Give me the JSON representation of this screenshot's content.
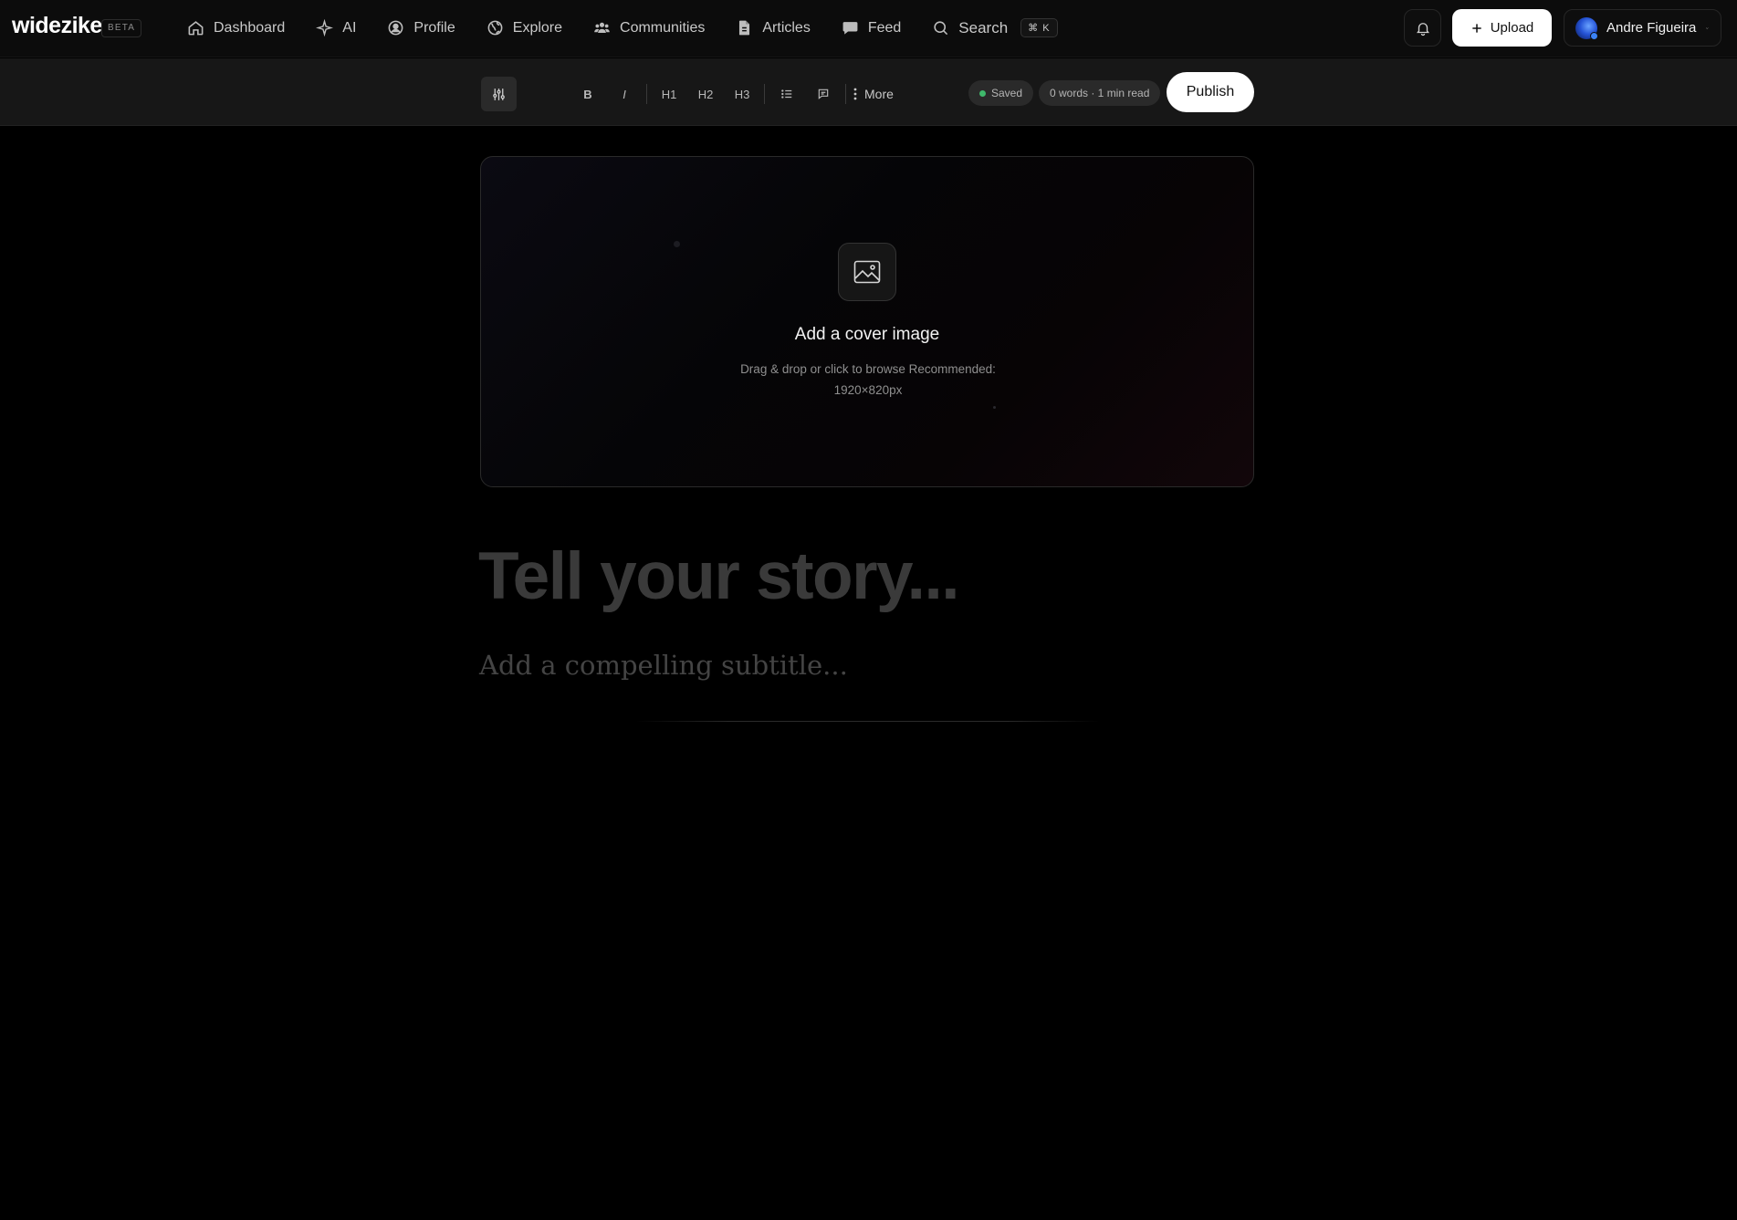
{
  "brand": {
    "logo": "widezike",
    "badge": "BETA"
  },
  "nav": {
    "items": [
      {
        "label": "Dashboard",
        "icon": "home-icon"
      },
      {
        "label": "AI",
        "icon": "sparkle-icon"
      },
      {
        "label": "Profile",
        "icon": "user-circle-icon"
      },
      {
        "label": "Explore",
        "icon": "globe-icon"
      },
      {
        "label": "Communities",
        "icon": "users-icon"
      },
      {
        "label": "Articles",
        "icon": "document-icon"
      },
      {
        "label": "Feed",
        "icon": "chat-bubble-icon"
      }
    ],
    "search": {
      "label": "Search",
      "shortcut": "⌘ K"
    }
  },
  "header": {
    "upload_label": "Upload",
    "user_name": "Andre Figueira"
  },
  "toolbar": {
    "bold": "B",
    "italic": "I",
    "h1": "H1",
    "h2": "H2",
    "h3": "H3",
    "more": "More",
    "status": "Saved",
    "word_count": "0 words · 1 min read",
    "publish": "Publish"
  },
  "cover": {
    "title": "Add a cover image",
    "subtitle": "Drag & drop or click to browse Recommended: 1920×820px"
  },
  "editor": {
    "title_placeholder": "Tell your story...",
    "subtitle_placeholder": "Add a compelling subtitle..."
  },
  "colors": {
    "background": "#000000",
    "topbar": "#0c0c0c",
    "toolbar": "#171717",
    "saved_dot": "#3fb86b",
    "button_primary": "#ffffff"
  }
}
